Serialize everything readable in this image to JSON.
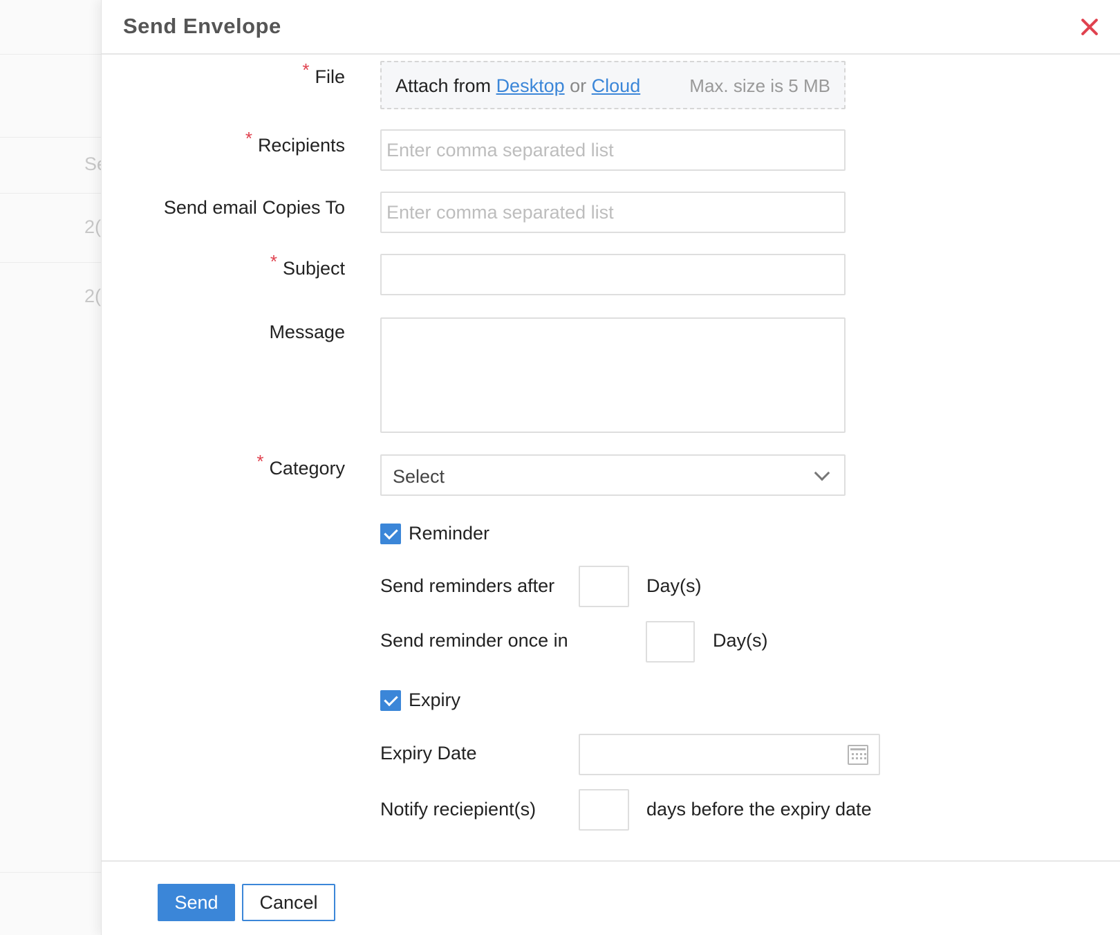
{
  "background_page": {
    "row_texts": [
      "Se",
      "2(",
      "2("
    ]
  },
  "dialog": {
    "title": "Send Envelope",
    "close_icon": "close-icon",
    "accent_color": "#3b86d8",
    "required_color": "#e0424f"
  },
  "form": {
    "required_marker": "*",
    "file": {
      "label": "File",
      "attach_prefix": "Attach from",
      "desktop_link": "Desktop",
      "or_text": "or",
      "cloud_link": "Cloud",
      "max_size": "Max. size is 5 MB"
    },
    "recipients": {
      "label": "Recipients",
      "placeholder": "Enter comma separated list",
      "value": ""
    },
    "copies": {
      "label": "Send email Copies To",
      "placeholder": "Enter comma separated list",
      "value": ""
    },
    "subject": {
      "label": "Subject",
      "value": ""
    },
    "message": {
      "label": "Message",
      "value": ""
    },
    "category": {
      "label": "Category",
      "selected": "Select",
      "icon": "chevron-down-icon"
    },
    "reminder": {
      "checkbox_label": "Reminder",
      "checked": true,
      "after_label": "Send reminders after",
      "after_suffix": "Day(s)",
      "once_label": "Send reminder once in",
      "once_suffix": "Day(s)"
    },
    "expiry": {
      "checkbox_label": "Expiry",
      "checked": true,
      "date_label": "Expiry Date",
      "date_icon": "calendar-icon",
      "notify_label": "Notify reciepient(s)",
      "notify_suffix": "days before the expiry date"
    }
  },
  "footer": {
    "send_label": "Send",
    "cancel_label": "Cancel"
  }
}
